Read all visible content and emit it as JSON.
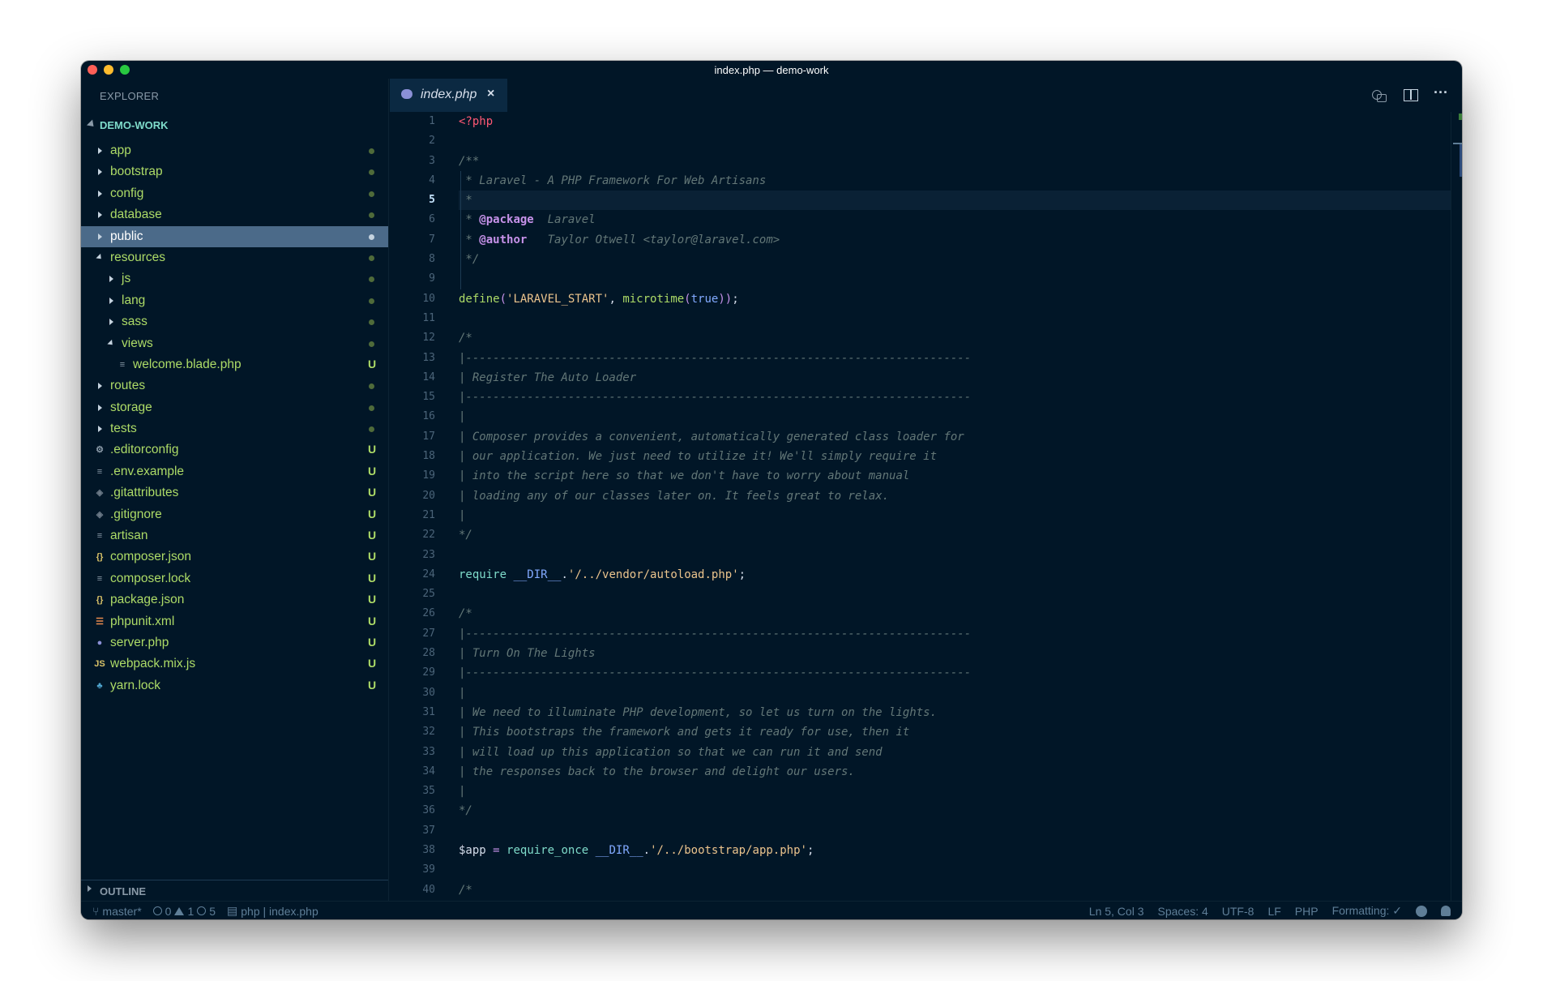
{
  "window": {
    "title": "index.php — demo-work"
  },
  "explorer": {
    "title": "EXPLORER",
    "project": "DEMO-WORK",
    "items": [
      {
        "name": "app",
        "type": "folder",
        "depth": 0,
        "expanded": false,
        "status": "dot"
      },
      {
        "name": "bootstrap",
        "type": "folder",
        "depth": 0,
        "expanded": false,
        "status": "dot"
      },
      {
        "name": "config",
        "type": "folder",
        "depth": 0,
        "expanded": false,
        "status": "dot"
      },
      {
        "name": "database",
        "type": "folder",
        "depth": 0,
        "expanded": false,
        "status": "dot"
      },
      {
        "name": "public",
        "type": "folder",
        "depth": 0,
        "expanded": false,
        "status": "dot",
        "selected": true
      },
      {
        "name": "resources",
        "type": "folder",
        "depth": 0,
        "expanded": true,
        "status": "dot"
      },
      {
        "name": "js",
        "type": "folder",
        "depth": 1,
        "expanded": false,
        "status": "dot"
      },
      {
        "name": "lang",
        "type": "folder",
        "depth": 1,
        "expanded": false,
        "status": "dot"
      },
      {
        "name": "sass",
        "type": "folder",
        "depth": 1,
        "expanded": false,
        "status": "dot"
      },
      {
        "name": "views",
        "type": "folder",
        "depth": 1,
        "expanded": true,
        "status": "dot"
      },
      {
        "name": "welcome.blade.php",
        "type": "file",
        "icon": "lines-icon",
        "depth": 2,
        "status": "U"
      },
      {
        "name": "routes",
        "type": "folder",
        "depth": 0,
        "expanded": false,
        "status": "dot"
      },
      {
        "name": "storage",
        "type": "folder",
        "depth": 0,
        "expanded": false,
        "status": "dot"
      },
      {
        "name": "tests",
        "type": "folder",
        "depth": 0,
        "expanded": false,
        "status": "dot"
      },
      {
        "name": ".editorconfig",
        "type": "file",
        "icon": "gear-icon",
        "depth": 0,
        "status": "U"
      },
      {
        "name": ".env.example",
        "type": "file",
        "icon": "lines-icon",
        "depth": 0,
        "status": "U"
      },
      {
        "name": ".gitattributes",
        "type": "file",
        "icon": "git-icon",
        "depth": 0,
        "status": "U"
      },
      {
        "name": ".gitignore",
        "type": "file",
        "icon": "git-icon",
        "depth": 0,
        "status": "U"
      },
      {
        "name": "artisan",
        "type": "file",
        "icon": "lines-icon",
        "depth": 0,
        "status": "U"
      },
      {
        "name": "composer.json",
        "type": "file",
        "icon": "braces-icon",
        "depth": 0,
        "status": "U"
      },
      {
        "name": "composer.lock",
        "type": "file",
        "icon": "lines-icon",
        "depth": 0,
        "status": "U"
      },
      {
        "name": "package.json",
        "type": "file",
        "icon": "braces-icon",
        "depth": 0,
        "status": "U"
      },
      {
        "name": "phpunit.xml",
        "type": "file",
        "icon": "rss-icon",
        "depth": 0,
        "status": "U"
      },
      {
        "name": "server.php",
        "type": "file",
        "icon": "php-elephant-icon",
        "depth": 0,
        "status": "U"
      },
      {
        "name": "webpack.mix.js",
        "type": "file",
        "icon": "js-icon",
        "depth": 0,
        "status": "U"
      },
      {
        "name": "yarn.lock",
        "type": "file",
        "icon": "yarn-icon",
        "depth": 0,
        "status": "U"
      }
    ],
    "outline": "OUTLINE"
  },
  "tab": {
    "label": "index.php",
    "close": "×"
  },
  "editor": {
    "active_line": 5,
    "lines": [
      [
        [
          "tag",
          "<?php"
        ]
      ],
      [],
      [
        [
          "cm",
          "/**"
        ]
      ],
      [
        [
          "cm",
          " * Laravel - A PHP Framework For Web Artisans"
        ]
      ],
      [
        [
          "cm",
          " *"
        ]
      ],
      [
        [
          "cm",
          " * "
        ],
        [
          "doc",
          "@package"
        ],
        [
          "cm",
          "  Laravel"
        ]
      ],
      [
        [
          "cm",
          " * "
        ],
        [
          "doc",
          "@author"
        ],
        [
          "cm",
          "   Taylor Otwell <taylor@laravel.com>"
        ]
      ],
      [
        [
          "cm",
          " */"
        ]
      ],
      [],
      [
        [
          "fy",
          "define"
        ],
        [
          "pu",
          "("
        ],
        [
          "st",
          "'LARAVEL_START'"
        ],
        [
          "pl",
          ", "
        ],
        [
          "fy",
          "microtime"
        ],
        [
          "pu",
          "("
        ],
        [
          "bo",
          "true"
        ],
        [
          "pu",
          "))"
        ],
        [
          "pl",
          ";"
        ]
      ],
      [],
      [
        [
          "cm",
          "/*"
        ]
      ],
      [
        [
          "cm",
          "|--------------------------------------------------------------------------"
        ]
      ],
      [
        [
          "cm",
          "| Register The Auto Loader"
        ]
      ],
      [
        [
          "cm",
          "|--------------------------------------------------------------------------"
        ]
      ],
      [
        [
          "cm",
          "|"
        ]
      ],
      [
        [
          "cm",
          "| Composer provides a convenient, automatically generated class loader for"
        ]
      ],
      [
        [
          "cm",
          "| our application. We just need to utilize it! We'll simply require it"
        ]
      ],
      [
        [
          "cm",
          "| into the script here so that we don't have to worry about manual"
        ]
      ],
      [
        [
          "cm",
          "| loading any of our classes later on. It feels great to relax."
        ]
      ],
      [
        [
          "cm",
          "|"
        ]
      ],
      [
        [
          "cm",
          "*/"
        ]
      ],
      [],
      [
        [
          "req",
          "require"
        ],
        [
          "pl",
          " "
        ],
        [
          "co",
          "__DIR__"
        ],
        [
          "pl",
          "."
        ],
        [
          "st",
          "'/../vendor/autoload.php'"
        ],
        [
          "pl",
          ";"
        ]
      ],
      [],
      [
        [
          "cm",
          "/*"
        ]
      ],
      [
        [
          "cm",
          "|--------------------------------------------------------------------------"
        ]
      ],
      [
        [
          "cm",
          "| Turn On The Lights"
        ]
      ],
      [
        [
          "cm",
          "|--------------------------------------------------------------------------"
        ]
      ],
      [
        [
          "cm",
          "|"
        ]
      ],
      [
        [
          "cm",
          "| We need to illuminate PHP development, so let us turn on the lights."
        ]
      ],
      [
        [
          "cm",
          "| This bootstraps the framework and gets it ready for use, then it"
        ]
      ],
      [
        [
          "cm",
          "| will load up this application so that we can run it and send"
        ]
      ],
      [
        [
          "cm",
          "| the responses back to the browser and delight our users."
        ]
      ],
      [
        [
          "cm",
          "|"
        ]
      ],
      [
        [
          "cm",
          "*/"
        ]
      ],
      [],
      [
        [
          "va",
          "$app"
        ],
        [
          "pl",
          " "
        ],
        [
          "op",
          "="
        ],
        [
          "pl",
          " "
        ],
        [
          "req",
          "require_once"
        ],
        [
          "pl",
          " "
        ],
        [
          "co",
          "__DIR__"
        ],
        [
          "pl",
          "."
        ],
        [
          "st",
          "'/../bootstrap/app.php'"
        ],
        [
          "pl",
          ";"
        ]
      ],
      [],
      [
        [
          "cm",
          "/*"
        ]
      ]
    ]
  },
  "statusbar": {
    "branch": "master*",
    "errors": "0",
    "warnings": "1",
    "infos": "5",
    "language_breadcrumb": "php | index.php",
    "position": "Ln 5, Col 3",
    "spaces": "Spaces: 4",
    "encoding": "UTF-8",
    "eol": "LF",
    "language": "PHP",
    "formatting": "Formatting: ✓"
  }
}
